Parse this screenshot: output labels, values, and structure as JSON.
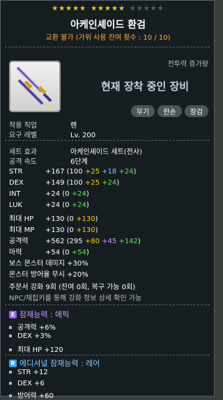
{
  "header": {
    "stars": {
      "group1_on": "★★★★★",
      "group2_on": "★★★★★",
      "group3_off": "★★★★★"
    },
    "title": "아케인셰이드 환검",
    "subtitle": "교환 불가 (가위 사용 잔여 횟수 : 10 / 10)"
  },
  "item": {
    "icon": "twin-sword-icon",
    "increase_label": "전투력 증가량",
    "equipped_text": "현재 장착 중인 장비",
    "tags": [
      "무기",
      "한손",
      "장검"
    ]
  },
  "requirements": [
    {
      "key": "착용 직업",
      "value": "렌"
    },
    {
      "key": "요구 레벨",
      "value": "Lv. 200"
    }
  ],
  "set": {
    "key": "세트 효과",
    "value": "아케인셰이드 세트(전사)"
  },
  "speed": {
    "key": "공격 속도",
    "value": "6단계"
  },
  "stats": {
    "str": {
      "label": "STR",
      "total": "+167",
      "open": "(100",
      "a": "+25",
      "b": "+18",
      "c": "+24",
      "close": ")"
    },
    "dex": {
      "label": "DEX",
      "total": "+149",
      "open": "(100",
      "a": "+25",
      "c": "+24",
      "close": ")"
    },
    "int": {
      "label": "INT",
      "total": "+24",
      "open": "(0",
      "c": "+24",
      "close": ")"
    },
    "luk": {
      "label": "LUK",
      "total": "+24",
      "open": "(0",
      "c": "+24",
      "close": ")"
    },
    "hp": {
      "label": "최대 HP",
      "total": "+130",
      "open": "(0",
      "a": "+130",
      "close": ")"
    },
    "mp": {
      "label": "최대 MP",
      "total": "+130",
      "open": "(0",
      "a": "+130",
      "close": ")"
    },
    "atk": {
      "label": "공격력",
      "total": "+562",
      "open": "(295",
      "a": "+80",
      "b": "+45",
      "c": "+142",
      "close": ")"
    },
    "mag": {
      "label": "마력",
      "total": "+54",
      "open": "(0",
      "c": "+54",
      "close": ")"
    },
    "boss": "보스 몬스터 데미지  +30%",
    "ignore": "몬스터 방어율 무시  +20%",
    "upgrade": "주문서 강화 9회 (잔여 0회, 복구 가능 0회)",
    "note": "NPC/채집키를 통해 강화 정보 상세 확인 가능"
  },
  "potential": {
    "badge": "E",
    "badge_color": "#9b5cf0",
    "title": "잠재능력 : 에픽",
    "lines": [
      "공격력 +6%",
      "DEX +3%",
      "최대 HP +120"
    ]
  },
  "additional": {
    "badge": "R",
    "badge_color": "#3aa0e0",
    "title": "에디셔널 잠재능력 : 레어",
    "lines": [
      "STR +12",
      "DEX +6",
      "방어력 +60"
    ]
  }
}
